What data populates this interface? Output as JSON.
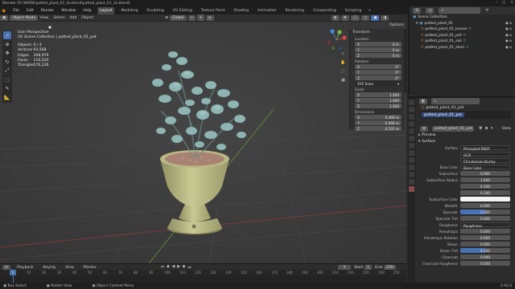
{
  "window": {
    "title": "Blender [D:\\WORK\\potted_plant_01_1k.blend\\potted_plant_01_1k.blend]"
  },
  "menu": {
    "items": [
      "File",
      "Edit",
      "Render",
      "Window",
      "Help"
    ]
  },
  "workspaces": {
    "items": [
      "Layout",
      "Modeling",
      "Sculpting",
      "UV Editing",
      "Texture Paint",
      "Shading",
      "Animation",
      "Rendering",
      "Compositing",
      "Scripting"
    ],
    "active": "Layout"
  },
  "scene_selector": {
    "scene": "Scene",
    "view_layer": "View Layer"
  },
  "viewport_header": {
    "mode": "Object Mode",
    "view": "View",
    "select": "Select",
    "add": "Add",
    "object": "Object",
    "orientation": "Global",
    "options": "Options"
  },
  "viewport_overlay": {
    "view_name": "User Perspective",
    "collection": "(0) Scene Collection | potted_plant_01_pot"
  },
  "stats": [
    {
      "label": "Objects",
      "value": "0 / 4"
    },
    {
      "label": "Vertices",
      "value": "93,568"
    },
    {
      "label": "Edges",
      "value": "208,979"
    },
    {
      "label": "Faces",
      "value": "116,520"
    },
    {
      "label": "Triangles",
      "value": "176,226"
    }
  ],
  "npanel": {
    "title": "Transform",
    "location_label": "Location",
    "location": [
      {
        "axis": "X",
        "value": "0 m"
      },
      {
        "axis": "Y",
        "value": "0 m"
      },
      {
        "axis": "Z",
        "value": "0 m"
      }
    ],
    "rotation_label": "Rotation",
    "rotation": [
      {
        "axis": "X",
        "value": "0°"
      },
      {
        "axis": "Y",
        "value": "0°"
      },
      {
        "axis": "Z",
        "value": "0°"
      }
    ],
    "rotation_mode": "XYZ Euler",
    "scale_label": "Scale",
    "scale": [
      {
        "axis": "X",
        "value": "1.000"
      },
      {
        "axis": "Y",
        "value": "1.000"
      },
      {
        "axis": "Z",
        "value": "1.000"
      }
    ],
    "dimensions_label": "Dimensions",
    "dimensions": [
      {
        "axis": "X",
        "value": "0.466 m"
      },
      {
        "axis": "Y",
        "value": "0.466 m"
      },
      {
        "axis": "Z",
        "value": "0.531 m"
      }
    ]
  },
  "outliner": {
    "root": "Scene Collection",
    "items": [
      {
        "name": "potted_plant_01",
        "level": 1
      },
      {
        "name": "potted_plant_01_leaves",
        "level": 2
      },
      {
        "name": "potted_plant_01_pot",
        "level": 2
      },
      {
        "name": "potted_plant_01_soil",
        "level": 2
      },
      {
        "name": "potted_plant_01_stem",
        "level": 2
      }
    ]
  },
  "properties": {
    "object_name": "potted_plant_01_pot",
    "material_slot": "potted_plant_01_pot",
    "material_name": "potted_plant_01_pot",
    "data_label": "Data",
    "preview": "Preview",
    "surface_section": "Surface",
    "surface_label": "Surface",
    "surface_value": "Principled BSDF",
    "dist_value": "GGX",
    "subsurf_method": "Christensen-Burley",
    "base_color_label": "Base Color",
    "base_color_value": "Base Color",
    "subsurface_label": "Subsurface",
    "subsurface_value": "0.000",
    "subsurface_radius_label": "Subsurface Radius",
    "subsurface_radius": [
      "1.000",
      "0.200",
      "0.100"
    ],
    "subsurface_color_label": "Subsurface Color",
    "metallic_label": "Metallic",
    "metallic_value": "0.000",
    "specular_label": "Specular",
    "specular_value": "0.500",
    "specular_tint_label": "Specular Tint",
    "specular_tint_value": "0.000",
    "roughness_label": "Roughness",
    "roughness_value": "Roughness",
    "anisotropic_label": "Anisotropic",
    "anisotropic_value": "0.000",
    "aniso_rot_label": "Anisotropic Rotation",
    "aniso_rot_value": "0.000",
    "sheen_label": "Sheen",
    "sheen_value": "0.000",
    "sheen_tint_label": "Sheen Tint",
    "sheen_tint_value": "0.500",
    "clearcoat_label": "Clearcoat",
    "clearcoat_value": "0.000",
    "clearcoat_rough_label": "Clearcoat Roughness",
    "clearcoat_rough_value": "0.030"
  },
  "timeline": {
    "menus": [
      "Playback",
      "Keying",
      "View",
      "Marker"
    ],
    "current_frame": "1",
    "start_label": "Start",
    "start": "1",
    "end_label": "End",
    "end": "250",
    "ticks": [
      "0",
      "10",
      "20",
      "30",
      "40",
      "50",
      "60",
      "70",
      "80",
      "90",
      "100",
      "110",
      "120",
      "130",
      "140",
      "150",
      "160",
      "170",
      "180",
      "190",
      "200",
      "210",
      "220",
      "230",
      "240",
      "250"
    ]
  },
  "statusbar": {
    "select": "Box Select",
    "rotate": "Rotate View",
    "context": "Object Context Menu",
    "version": "2.92.0"
  },
  "colors": {
    "accent": "#4772b3",
    "leaf": "#8fb5b2",
    "pot": "#c2c28a",
    "soil": "#b8877a"
  }
}
